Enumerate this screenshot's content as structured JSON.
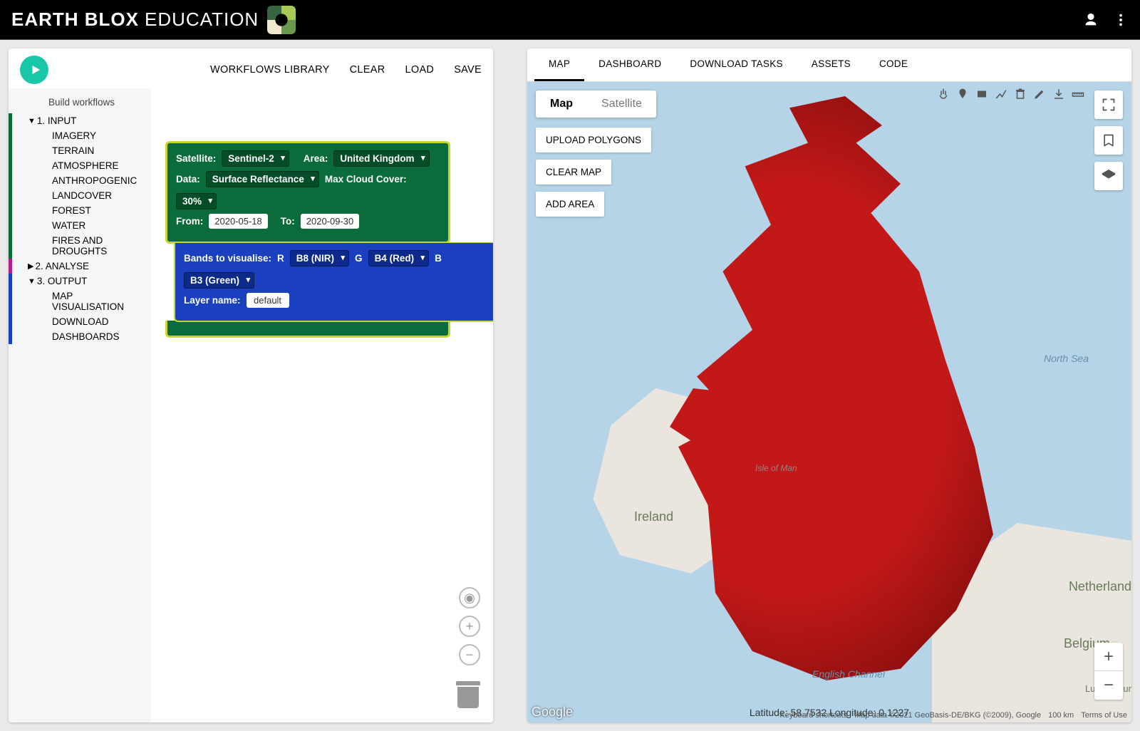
{
  "header": {
    "brand_bold": "EARTH BLOX",
    "brand_light": "EDUCATION"
  },
  "toolbar": {
    "workflows_library": "WORKFLOWS LIBRARY",
    "clear": "CLEAR",
    "load": "LOAD",
    "save": "SAVE"
  },
  "sidebar": {
    "title": "Build workflows",
    "sections": {
      "input": {
        "label": "1. INPUT",
        "expanded": true,
        "items": [
          "IMAGERY",
          "TERRAIN",
          "ATMOSPHERE",
          "ANTHROPOGENIC",
          "LANDCOVER",
          "FOREST",
          "WATER",
          "FIRES AND DROUGHTS"
        ]
      },
      "analyse": {
        "label": "2. ANALYSE",
        "expanded": false
      },
      "output": {
        "label": "3. OUTPUT",
        "expanded": true,
        "items": [
          "MAP VISUALISATION",
          "DOWNLOAD",
          "DASHBOARDS"
        ]
      }
    }
  },
  "block_input": {
    "sat_label": "Satellite:",
    "sat_value": "Sentinel-2",
    "area_label": "Area:",
    "area_value": "United Kingdom",
    "data_label": "Data:",
    "data_value": "Surface Reflectance",
    "cloud_label": "Max Cloud Cover:",
    "cloud_value": "30%",
    "from_label": "From:",
    "from_value": "2020-05-18",
    "to_label": "To:",
    "to_value": "2020-09-30"
  },
  "block_output": {
    "bands_label": "Bands to visualise:",
    "r_label": "R",
    "r_value": "B8 (NIR)",
    "g_label": "G",
    "g_value": "B4 (Red)",
    "b_label": "B",
    "b_value": "B3 (Green)",
    "layer_label": "Layer name:",
    "layer_value": "default"
  },
  "right": {
    "tabs": [
      "MAP",
      "DASHBOARD",
      "DOWNLOAD TASKS",
      "ASSETS",
      "CODE"
    ],
    "active_tab": 0,
    "maptype": {
      "map": "Map",
      "sat": "Satellite"
    },
    "buttons": {
      "upload": "UPLOAD POLYGONS",
      "clear": "CLEAR MAP",
      "add": "ADD AREA"
    },
    "labels": {
      "northsea": "North Sea",
      "ireland": "Ireland",
      "isleofman": "Isle of Man",
      "englishchannel": "English Channel",
      "netherlands": "Netherland",
      "belgium": "Belgium",
      "luxembourg": "Luxembour"
    },
    "coords": "Latitude: 58.7532 Longitude: 0.1227",
    "attrib": {
      "shortcuts": "Keyboard shortcuts",
      "data": "Map data ©2021 GeoBasis-DE/BKG (©2009), Google",
      "scale": "100 km",
      "terms": "Terms of Use"
    },
    "google": "Google"
  }
}
